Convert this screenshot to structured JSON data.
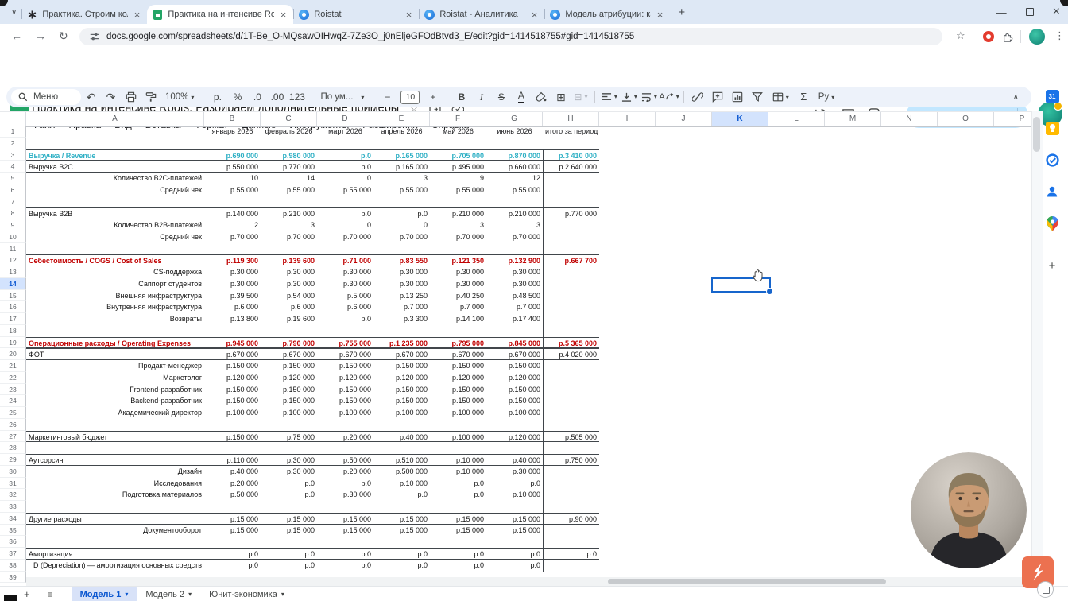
{
  "colors": {
    "accent_blue": "#0b57d0",
    "selection_blue": "#1765cc",
    "teal_text": "#2fb0c5",
    "red_text": "#c00000",
    "share_button_bg": "#c2e7ff",
    "header_selected_bg": "#d3e3fd"
  },
  "browser": {
    "tabs": [
      {
        "title": "Практика. Строим количестве",
        "icon": "asterisk",
        "active": false
      },
      {
        "title": "Практика на интенсиве Roots",
        "icon": "sheets",
        "active": true
      },
      {
        "title": "Roistat",
        "icon": "roistat",
        "active": false
      },
      {
        "title": "Roistat - Аналитика",
        "icon": "roistat",
        "active": false
      },
      {
        "title": "Модель атрибуции: какая под",
        "icon": "roistat",
        "active": false
      }
    ],
    "url": "docs.google.com/spreadsheets/d/1T-Be_O-MQsawOIHwqZ-7Ze3O_j0nEljeGFOdBtvd3_E/edit?gid=1414518755#gid=1414518755"
  },
  "header": {
    "title": "Практика на интенсиве Roots. Разбираем дополнительные примеры",
    "menus": [
      "Файл",
      "Правка",
      "Вид",
      "Вставка",
      "Формат",
      "Данные",
      "Инструменты",
      "Расширения",
      "Справка"
    ],
    "share_label": "Настройки Доступа"
  },
  "toolbar": {
    "menu_label": "Меню",
    "zoom": "100%",
    "currency": "р.",
    "percent": "%",
    "dec0": ".0",
    "dec00": ".00",
    "fmt123": "123",
    "font": "По ум...",
    "font_size": "10",
    "bold": "B",
    "italic": "I",
    "strike": "S",
    "color_a": "A",
    "sigma": "Σ",
    "input_tools": "Ру"
  },
  "side_panel": {
    "calendar_label": "31"
  },
  "sheet": {
    "columns": [
      "A",
      "B",
      "C",
      "D",
      "E",
      "F",
      "G",
      "H",
      "I",
      "J",
      "K",
      "L",
      "M",
      "N",
      "O",
      "P"
    ],
    "selected_column": "K",
    "selected_row": 14,
    "selected_cell": "K14",
    "grid_rows": [
      {
        "n": 1,
        "type": "months",
        "v": [
          "январь 2026",
          "февраль 2026",
          "март 2026",
          "апрель 2026",
          "май 2026",
          "июнь 2026"
        ],
        "t": "итого за период"
      },
      {
        "n": 2
      },
      {
        "n": 3,
        "label": "Выручка / Revenue",
        "st": "teal",
        "box": true,
        "v": [
          "р.690 000",
          "р.980 000",
          "р.0",
          "р.165 000",
          "р.705 000",
          "р.870 000"
        ],
        "t": "р.3 410 000"
      },
      {
        "n": 4,
        "label": "Выручка B2C",
        "box": true,
        "v": [
          "р.550 000",
          "р.770 000",
          "р.0",
          "р.165 000",
          "р.495 000",
          "р.660 000"
        ],
        "t": "р.2 640 000"
      },
      {
        "n": 5,
        "label": "Количество B2C-платежей",
        "la": "r",
        "v": [
          "10",
          "14",
          "0",
          "3",
          "9",
          "12"
        ],
        "t": ""
      },
      {
        "n": 6,
        "label": "Средний чек",
        "la": "r",
        "v": [
          "р.55 000",
          "р.55 000",
          "р.55 000",
          "р.55 000",
          "р.55 000",
          "р.55 000"
        ],
        "t": ""
      },
      {
        "n": 7
      },
      {
        "n": 8,
        "label": "Выручка B2B",
        "box": true,
        "v": [
          "р.140 000",
          "р.210 000",
          "р.0",
          "р.0",
          "р.210 000",
          "р.210 000"
        ],
        "t": "р.770 000"
      },
      {
        "n": 9,
        "label": "Количество B2B-платежей",
        "la": "r",
        "v": [
          "2",
          "3",
          "0",
          "0",
          "3",
          "3"
        ],
        "t": ""
      },
      {
        "n": 10,
        "label": "Средний чек",
        "la": "r",
        "v": [
          "р.70 000",
          "р.70 000",
          "р.70 000",
          "р.70 000",
          "р.70 000",
          "р.70 000"
        ],
        "t": ""
      },
      {
        "n": 11
      },
      {
        "n": 12,
        "label": "Себестоимость / COGS / Cost of Sales",
        "st": "red",
        "box": true,
        "v": [
          "р.119 300",
          "р.139 600",
          "р.71 000",
          "р.83 550",
          "р.121 350",
          "р.132 900"
        ],
        "t": "р.667 700"
      },
      {
        "n": 13,
        "label": "CS-поддержка",
        "la": "r",
        "v": [
          "р.30 000",
          "р.30 000",
          "р.30 000",
          "р.30 000",
          "р.30 000",
          "р.30 000"
        ],
        "t": ""
      },
      {
        "n": 14,
        "label": "Саппорт студентов",
        "la": "r",
        "v": [
          "р.30 000",
          "р.30 000",
          "р.30 000",
          "р.30 000",
          "р.30 000",
          "р.30 000"
        ],
        "t": ""
      },
      {
        "n": 15,
        "label": "Внешняя инфраструктура",
        "la": "r",
        "v": [
          "р.39 500",
          "р.54 000",
          "р.5 000",
          "р.13 250",
          "р.40 250",
          "р.48 500"
        ],
        "t": ""
      },
      {
        "n": 16,
        "label": "Внутренняя инфраструктура",
        "la": "r",
        "v": [
          "р.6 000",
          "р.6 000",
          "р.6 000",
          "р.7 000",
          "р.7 000",
          "р.7 000"
        ],
        "t": ""
      },
      {
        "n": 17,
        "label": "Возвраты",
        "la": "r",
        "v": [
          "р.13 800",
          "р.19 600",
          "р.0",
          "р.3 300",
          "р.14 100",
          "р.17 400"
        ],
        "t": ""
      },
      {
        "n": 18
      },
      {
        "n": 19,
        "label": "Операционные расходы / Operating Expenses",
        "st": "red",
        "box": true,
        "v": [
          "р.945 000",
          "р.790 000",
          "р.755 000",
          "р.1 235 000",
          "р.795 000",
          "р.845 000"
        ],
        "t": "р.5 365 000"
      },
      {
        "n": 20,
        "label": "ФОТ",
        "box": true,
        "v": [
          "р.670 000",
          "р.670 000",
          "р.670 000",
          "р.670 000",
          "р.670 000",
          "р.670 000"
        ],
        "t": "р.4 020 000"
      },
      {
        "n": 21,
        "label": "Продакт-менеджер",
        "la": "r",
        "v": [
          "р.150 000",
          "р.150 000",
          "р.150 000",
          "р.150 000",
          "р.150 000",
          "р.150 000"
        ],
        "t": ""
      },
      {
        "n": 22,
        "label": "Маркетолог",
        "la": "r",
        "v": [
          "р.120 000",
          "р.120 000",
          "р.120 000",
          "р.120 000",
          "р.120 000",
          "р.120 000"
        ],
        "t": ""
      },
      {
        "n": 23,
        "label": "Frontend-разработчик",
        "la": "r",
        "v": [
          "р.150 000",
          "р.150 000",
          "р.150 000",
          "р.150 000",
          "р.150 000",
          "р.150 000"
        ],
        "t": ""
      },
      {
        "n": 24,
        "label": "Backend-разработчик",
        "la": "r",
        "v": [
          "р.150 000",
          "р.150 000",
          "р.150 000",
          "р.150 000",
          "р.150 000",
          "р.150 000"
        ],
        "t": ""
      },
      {
        "n": 25,
        "label": "Академический директор",
        "la": "r",
        "v": [
          "р.100 000",
          "р.100 000",
          "р.100 000",
          "р.100 000",
          "р.100 000",
          "р.100 000"
        ],
        "t": ""
      },
      {
        "n": 26
      },
      {
        "n": 27,
        "label": "Маркетинговый бюджет",
        "box": true,
        "v": [
          "р.150 000",
          "р.75 000",
          "р.20 000",
          "р.40 000",
          "р.100 000",
          "р.120 000"
        ],
        "t": "р.505 000"
      },
      {
        "n": 28
      },
      {
        "n": 29,
        "label": "Аутсорсинг",
        "box": true,
        "v": [
          "р.110 000",
          "р.30 000",
          "р.50 000",
          "р.510 000",
          "р.10 000",
          "р.40 000"
        ],
        "t": "р.750 000"
      },
      {
        "n": 30,
        "label": "Дизайн",
        "la": "r",
        "v": [
          "р.40 000",
          "р.30 000",
          "р.20 000",
          "р.500 000",
          "р.10 000",
          "р.30 000"
        ],
        "t": ""
      },
      {
        "n": 31,
        "label": "Исследования",
        "la": "r",
        "v": [
          "р.20 000",
          "р.0",
          "р.0",
          "р.10 000",
          "р.0",
          "р.0"
        ],
        "t": ""
      },
      {
        "n": 32,
        "label": "Подготовка материалов",
        "la": "r",
        "v": [
          "р.50 000",
          "р.0",
          "р.30 000",
          "р.0",
          "р.0",
          "р.10 000"
        ],
        "t": ""
      },
      {
        "n": 33
      },
      {
        "n": 34,
        "label": "Другие расходы",
        "box": true,
        "v": [
          "р.15 000",
          "р.15 000",
          "р.15 000",
          "р.15 000",
          "р.15 000",
          "р.15 000"
        ],
        "t": "р.90 000"
      },
      {
        "n": 35,
        "label": "Документооборот",
        "la": "r",
        "v": [
          "р.15 000",
          "р.15 000",
          "р.15 000",
          "р.15 000",
          "р.15 000",
          "р.15 000"
        ],
        "t": ""
      },
      {
        "n": 36
      },
      {
        "n": 37,
        "label": "Амортизация",
        "box": true,
        "v": [
          "р.0",
          "р.0",
          "р.0",
          "р.0",
          "р.0",
          "р.0"
        ],
        "t": "р.0"
      },
      {
        "n": 38,
        "label": "D (Depreciation) — амортизация основных средств",
        "la": "r",
        "v": [
          "р.0",
          "р.0",
          "р.0",
          "р.0",
          "р.0",
          "р.0"
        ],
        "t": ""
      }
    ]
  },
  "footer": {
    "sheet_tabs": [
      {
        "name": "Модель 1",
        "active": true
      },
      {
        "name": "Модель 2",
        "active": false
      },
      {
        "name": "Юнит-экономика",
        "active": false
      }
    ]
  }
}
